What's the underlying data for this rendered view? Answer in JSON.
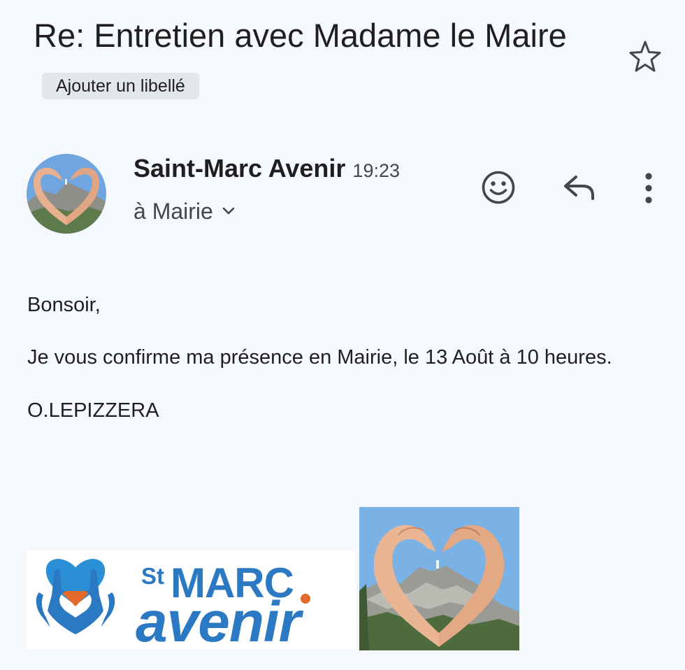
{
  "email": {
    "subject": "Re: Entretien avec Madame le Maire",
    "add_label_button": "Ajouter un libellé",
    "sender_name": "Saint-Marc Avenir",
    "time": "19:23",
    "recipient": "à Mairie",
    "body": {
      "greeting": "Bonsoir,",
      "confirmation": "Je vous confirme ma présence en Mairie, le 13 Août à 10 heures.",
      "signature": "O.LEPIZZERA"
    },
    "logo": {
      "st": "St",
      "marc": "MARC",
      "avenir": "avenir"
    }
  },
  "icons": {
    "star": "star-outline-icon",
    "emoji": "add-reaction-icon",
    "reply": "reply-icon",
    "more": "more-vert-icon",
    "expand": "chevron-down-icon"
  },
  "colors": {
    "background": "#f5f8fc",
    "text": "#1f1f1f",
    "secondary_text": "#444746",
    "label_chip": "#e3e6ea",
    "logo_blue": "#2b79c2",
    "logo_orange": "#e36a2a"
  }
}
